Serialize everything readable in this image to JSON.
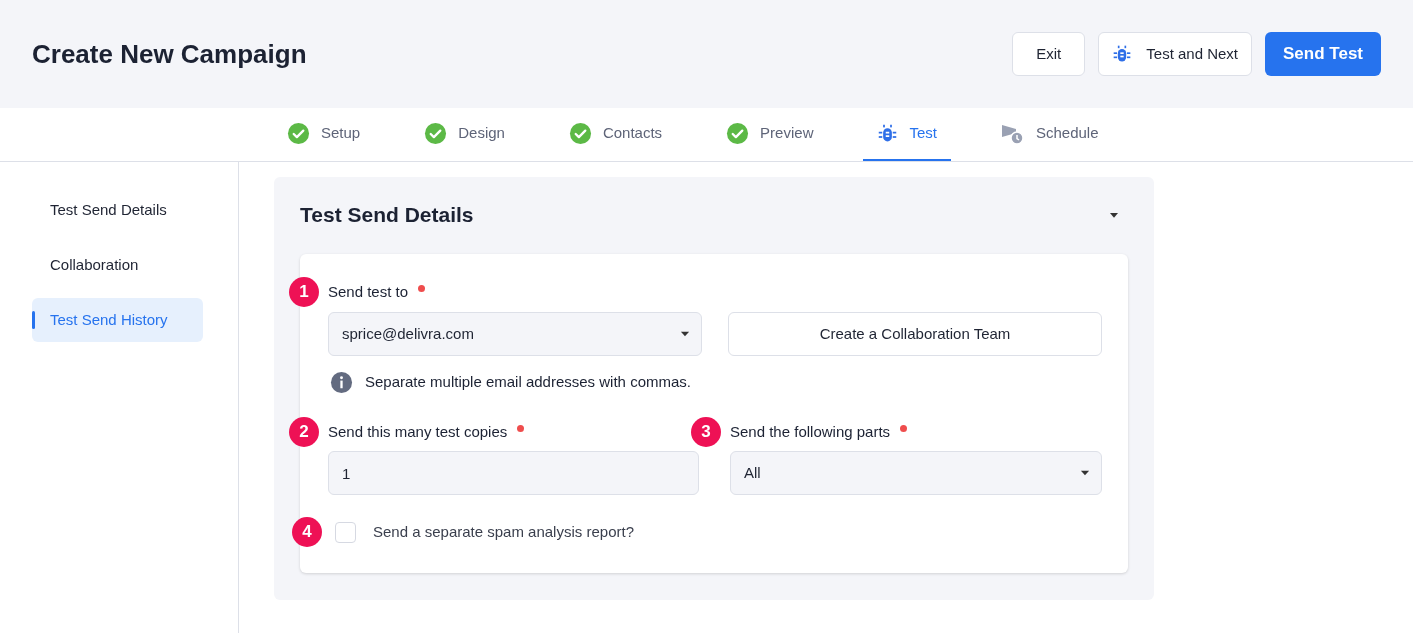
{
  "header": {
    "title": "Create New Campaign",
    "buttons": [
      {
        "label": "Exit",
        "kind": "plain"
      },
      {
        "label": "Test and Next",
        "kind": "icon"
      },
      {
        "label": "Send Test",
        "kind": "primary"
      }
    ]
  },
  "steps": [
    {
      "label": "Setup",
      "kind": "done",
      "selected": false
    },
    {
      "label": "Design",
      "kind": "done",
      "selected": false
    },
    {
      "label": "Contacts",
      "kind": "done",
      "selected": false
    },
    {
      "label": "Preview",
      "kind": "done",
      "selected": false
    },
    {
      "label": "Test",
      "kind": "test",
      "selected": true
    },
    {
      "label": "Schedule",
      "kind": "schedule",
      "selected": false
    }
  ],
  "sidebar": {
    "items": [
      {
        "label": "Test Send Details",
        "selected": false
      },
      {
        "label": "Collaboration",
        "selected": false
      },
      {
        "label": "Test Send History",
        "selected": true
      }
    ]
  },
  "panel": {
    "title": "Test Send Details",
    "expanded": true,
    "send_to": {
      "number": "1",
      "label": "Send test to",
      "required": true,
      "value": "sprice@delivra.com",
      "team_button": "Create a Collaboration Team",
      "hint": "Separate multiple email addresses with commas."
    },
    "copies": {
      "number": "2",
      "label": "Send this many test copies",
      "required": true,
      "value": "1"
    },
    "parts": {
      "number": "3",
      "label": "Send the following parts",
      "required": true,
      "value": "All"
    },
    "spam": {
      "number": "4",
      "label": "Send a separate spam analysis report?",
      "checked": false
    }
  }
}
